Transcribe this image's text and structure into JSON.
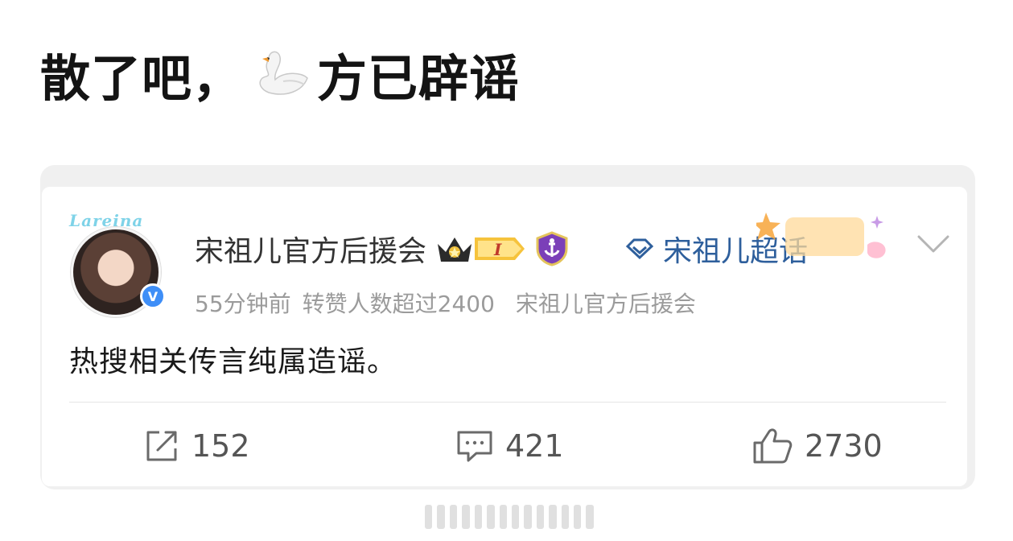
{
  "headline": {
    "text_before": "散了吧，",
    "emoji_icon": "swan-icon",
    "text_after": "方已辟谣"
  },
  "post": {
    "author": "宋祖儿官方后援会",
    "avatar_tag": "Lareina",
    "verified_badge": "V",
    "level_badge": "I",
    "supertopic": "宋祖儿超话",
    "meta": {
      "time": "55分钟前",
      "reposts_note": "转赞人数超过2400",
      "source": "宋祖儿官方后援会"
    },
    "text": "热搜相关传言纯属造谣。",
    "stats": {
      "shares": "152",
      "comments": "421",
      "likes": "2730"
    }
  },
  "colors": {
    "link_blue": "#2e5f9c",
    "verified_blue": "#3e8ef7",
    "meta_gray": "#9b9b9b",
    "card_border": "#f0f0f0"
  }
}
